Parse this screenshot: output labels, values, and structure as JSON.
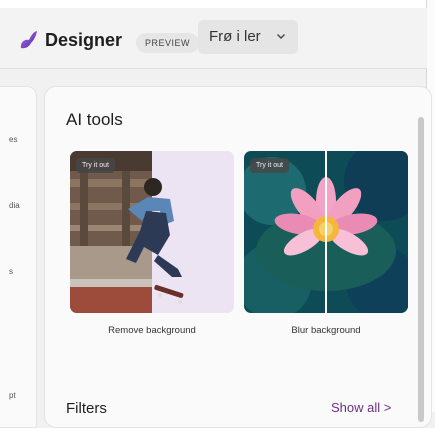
{
  "header": {
    "app_title": "Designer",
    "badge": "PREVIEW",
    "document_name": "Frø i ler",
    "icons": [
      "designer-logo-icon",
      "chevron-down-icon"
    ]
  },
  "left_panel": {
    "fragments": [
      "es",
      "dia",
      "s",
      "pt"
    ]
  },
  "ai_tools": {
    "title": "AI tools",
    "tiles": [
      {
        "badge": "Try it out",
        "caption": "Remove background"
      },
      {
        "badge": "Try it out",
        "caption": "Blur background"
      }
    ]
  },
  "filters": {
    "title": "Filters",
    "show_all": "Show all >"
  },
  "colors": {
    "accent": "#6d2f86",
    "logo": "#7a3cc8"
  }
}
